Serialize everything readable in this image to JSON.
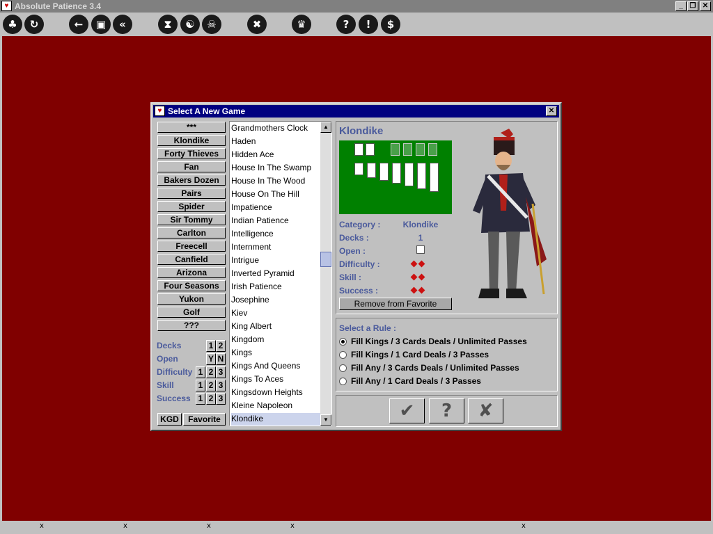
{
  "app": {
    "title": "Absolute Patience 3.4",
    "window_controls": [
      "_",
      "❐",
      "✕"
    ]
  },
  "toolbar": {
    "icons": [
      {
        "name": "club-icon",
        "glyph": "♣"
      },
      {
        "name": "restart-icon",
        "glyph": "↻"
      },
      {
        "name": "back-icon",
        "glyph": "←"
      },
      {
        "name": "camera-icon",
        "glyph": "▣"
      },
      {
        "name": "rewind-icon",
        "glyph": "«"
      },
      {
        "name": "hourglass-icon",
        "glyph": "⧗"
      },
      {
        "name": "yin-yang-icon",
        "glyph": "☯"
      },
      {
        "name": "skull-icon",
        "glyph": "☠"
      },
      {
        "name": "tools-icon",
        "glyph": "✖"
      },
      {
        "name": "trophy-icon",
        "glyph": "♛"
      },
      {
        "name": "help-icon",
        "glyph": "?"
      },
      {
        "name": "hint-icon",
        "glyph": "!"
      },
      {
        "name": "dollar-icon",
        "glyph": "$"
      }
    ]
  },
  "statusbar": {
    "marks": [
      "x",
      "x",
      "x",
      "x",
      "x"
    ]
  },
  "dialog": {
    "title": "Select A New Game",
    "close_glyph": "✕",
    "game_buttons": [
      "***",
      "Klondike",
      "Forty Thieves",
      "Fan",
      "Bakers Dozen",
      "Pairs",
      "Spider",
      "Sir Tommy",
      "Carlton",
      "Freecell",
      "Canfield",
      "Arizona",
      "Four Seasons",
      "Yukon",
      "Golf",
      "???"
    ],
    "filters": {
      "decks": {
        "label": "Decks",
        "options": [
          "1",
          "2"
        ]
      },
      "open": {
        "label": "Open",
        "options": [
          "Y",
          "N"
        ]
      },
      "difficulty": {
        "label": "Difficulty",
        "options": [
          "1",
          "2",
          "3"
        ]
      },
      "skill": {
        "label": "Skill",
        "options": [
          "1",
          "2",
          "3"
        ]
      },
      "success": {
        "label": "Success",
        "options": [
          "1",
          "2",
          "3"
        ]
      }
    },
    "bottom_buttons": {
      "kgd": "KGD",
      "favorite": "Favorite"
    },
    "game_list": [
      "Grandmothers Clock",
      "Haden",
      "Hidden Ace",
      "House In The Swamp",
      "House In The Wood",
      "House On The Hill",
      "Impatience",
      "Indian Patience",
      "Intelligence",
      "Internment",
      "Intrigue",
      "Inverted Pyramid",
      "Irish Patience",
      "Josephine",
      "Kiev",
      "King Albert",
      "Kingdom",
      "Kings",
      "Kings And Queens",
      "Kings To Aces",
      "Kingsdown Heights",
      "Kleine Napoleon",
      "Klondike"
    ],
    "selected_game": "Klondike",
    "scroll_up": "▲",
    "scroll_down": "▼",
    "info": {
      "game_title": "Klondike",
      "category_label": "Category :",
      "category_value": "Klondike",
      "decks_label": "Decks :",
      "decks_value": "1",
      "open_label": "Open :",
      "open_checked": false,
      "difficulty_label": "Difficulty :",
      "difficulty_level": 2,
      "skill_label": "Skill :",
      "skill_level": 2,
      "success_label": "Success :",
      "success_level": 2,
      "remove_favorite": "Remove from Favorite"
    },
    "rules": {
      "heading": "Select a Rule :",
      "options": [
        "Fill Kings / 3 Cards Deals / Unlimited Passes",
        "Fill Kings / 1 Card Deals / 3 Passes",
        "Fill Any / 3 Cards Deals / Unlimited Passes",
        "Fill Any / 1 Card Deals / 3 Passes"
      ],
      "selected_index": 0
    },
    "actions": {
      "ok_glyph": "✔",
      "help_glyph": "?",
      "cancel_glyph": "✘"
    }
  },
  "colors": {
    "table": "#800000",
    "dialog_title": "#000080",
    "label_blue": "#4a5a9c",
    "preview_green": "#008000",
    "diamond_red": "#cc1111"
  }
}
